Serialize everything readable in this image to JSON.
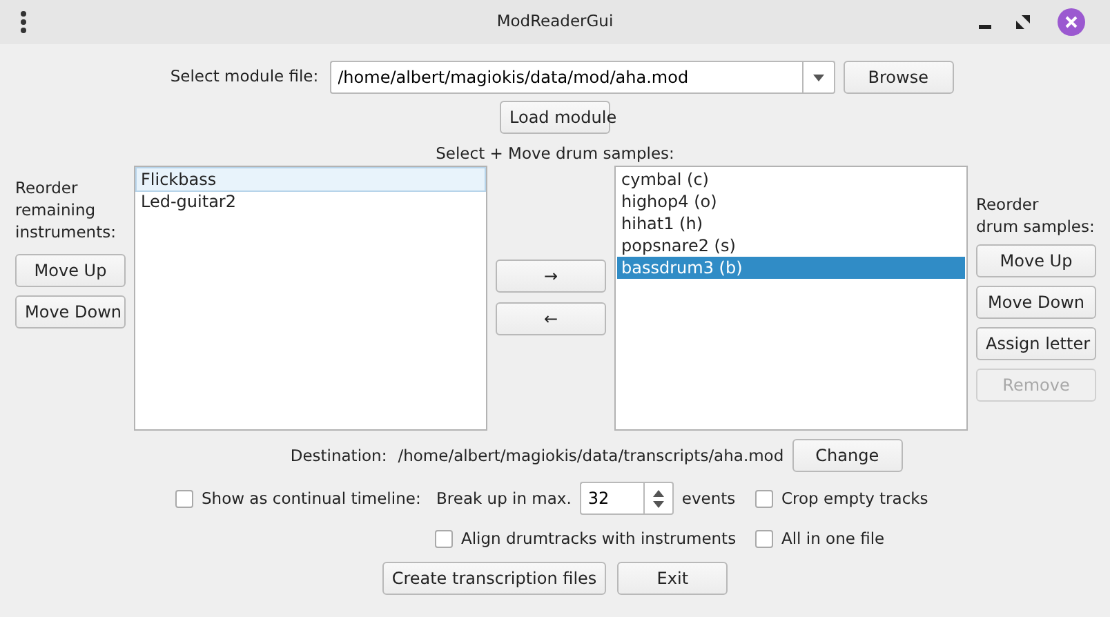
{
  "window": {
    "title": "ModReaderGui"
  },
  "module_file": {
    "label": "Select module file:",
    "value": "/home/albert/magiokis/data/mod/aha.mod",
    "browse_button": "Browse",
    "load_button": "Load module"
  },
  "drum_section_label": "Select + Move drum samples:",
  "instruments": {
    "label": "Reorder\nremaining\ninstruments:",
    "buttons": [
      {
        "label": "Move Up",
        "disabled": false
      },
      {
        "label": "Move Down",
        "disabled": false
      }
    ],
    "items": [
      {
        "label": "Flickbass",
        "selected": false,
        "current": true
      },
      {
        "label": "Led-guitar2",
        "selected": false,
        "current": false
      }
    ]
  },
  "move_buttons": [
    {
      "label": "→"
    },
    {
      "label": "←"
    }
  ],
  "drums": {
    "label": "Reorder\ndrum samples:",
    "buttons": [
      {
        "label": "Move Up",
        "disabled": false
      },
      {
        "label": "Move Down",
        "disabled": false
      },
      {
        "label": "Assign letter",
        "disabled": false
      },
      {
        "label": "Remove",
        "disabled": true
      }
    ],
    "items": [
      {
        "label": "cymbal (c)",
        "selected": false,
        "current": false
      },
      {
        "label": "highop4 (o)",
        "selected": false,
        "current": false
      },
      {
        "label": "hihat1 (h)",
        "selected": false,
        "current": false
      },
      {
        "label": "popsnare2 (s)",
        "selected": false,
        "current": false
      },
      {
        "label": "bassdrum3 (b)",
        "selected": true,
        "current": false
      }
    ]
  },
  "destination": {
    "label": "Destination:",
    "path": "/home/albert/magiokis/data/transcripts/aha.mod",
    "button": "Change"
  },
  "timeline": {
    "label": "Show as continual timeline:",
    "checked": false
  },
  "break_up": {
    "label": "Break up in max.",
    "value": "32",
    "unit": "events"
  },
  "crop_empty": {
    "label": "Crop empty tracks",
    "checked": false
  },
  "align": {
    "label": "Align drumtracks with instruments",
    "checked": false
  },
  "all_in_one": {
    "label": "All in one file",
    "checked": false
  },
  "buttons": [
    "Create transcription files",
    "Exit"
  ]
}
